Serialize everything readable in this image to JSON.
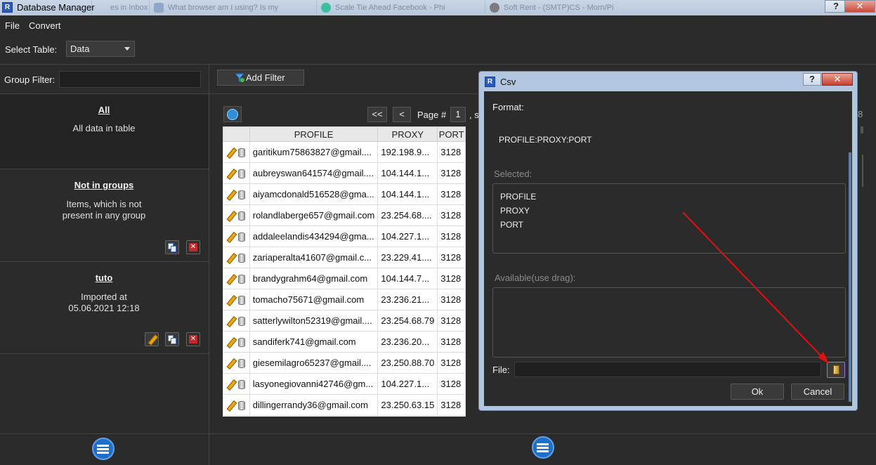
{
  "window": {
    "title": "Database Manager"
  },
  "browser_tabs": [
    "es in Inbox) -",
    "What browser am I using? Is my",
    "Scale Tie Ahead Facebook - Phi",
    "Soft Rent - (SMTP)CS - Morn/Pi"
  ],
  "menu": {
    "file": "File",
    "convert": "Convert"
  },
  "select_table": {
    "label": "Select Table:",
    "value": "Data"
  },
  "group_filter": {
    "label": "Group Filter:"
  },
  "groups": [
    {
      "title": "All",
      "desc": [
        "All data in table"
      ]
    },
    {
      "title": "Not in groups",
      "desc": [
        "Items, which is not",
        "present in any group"
      ]
    },
    {
      "title": "tuto",
      "desc": [
        "Imported at",
        "05.06.2021 12:18"
      ]
    }
  ],
  "toolbar": {
    "add_filter": "Add Filter"
  },
  "pager": {
    "first": "<<",
    "prev": "<",
    "page_label": "Page #",
    "page": "1",
    "rest": ", s"
  },
  "table": {
    "columns": [
      "PROFILE",
      "PROXY",
      "PORT"
    ],
    "rows": [
      [
        "garitikum75863827@gmail....",
        "192.198.9...",
        "3128"
      ],
      [
        "aubreyswan641574@gmail....",
        "104.144.1...",
        "3128"
      ],
      [
        "aiyamcdonald516528@gma...",
        "104.144.1...",
        "3128"
      ],
      [
        "rolandlaberge657@gmail.com",
        "23.254.68....",
        "3128"
      ],
      [
        "addaleelandis434294@gma...",
        "104.227.1...",
        "3128"
      ],
      [
        "zariaperalta41607@gmail.c...",
        "23.229.41....",
        "3128"
      ],
      [
        "brandygrahm64@gmail.com",
        "104.144.7...",
        "3128"
      ],
      [
        "tomacho75671@gmail.com",
        "23.236.21...",
        "3128"
      ],
      [
        "satterlywilton52319@gmail....",
        "23.254.68.79",
        "3128"
      ],
      [
        "sandiferk741@gmail.com",
        "23.236.20...",
        "3128"
      ],
      [
        "giesemilagro65237@gmail....",
        "23.250.88.70",
        "3128"
      ],
      [
        "lasyonegiovanni42746@gm...",
        "104.227.1...",
        "3128"
      ],
      [
        "dillingerrandy36@gmail.com",
        "23.250.63.15",
        "3128"
      ]
    ]
  },
  "right_edge": {
    "digit": "8"
  },
  "csv_dialog": {
    "title": "Csv",
    "help": "?",
    "format_label": "Format:",
    "format_value": "PROFILE:PROXY:PORT",
    "selected_label": "Selected:",
    "selected_items": [
      "PROFILE",
      "PROXY",
      "PORT"
    ],
    "available_label": "Available(use drag):",
    "file_label": "File:",
    "ok": "Ok",
    "cancel": "Cancel"
  },
  "colors": {
    "background": "#2b2b2b",
    "accent": "#1f6fc9",
    "arrow": "#e01010",
    "titlebar": "#b7c7dc"
  }
}
